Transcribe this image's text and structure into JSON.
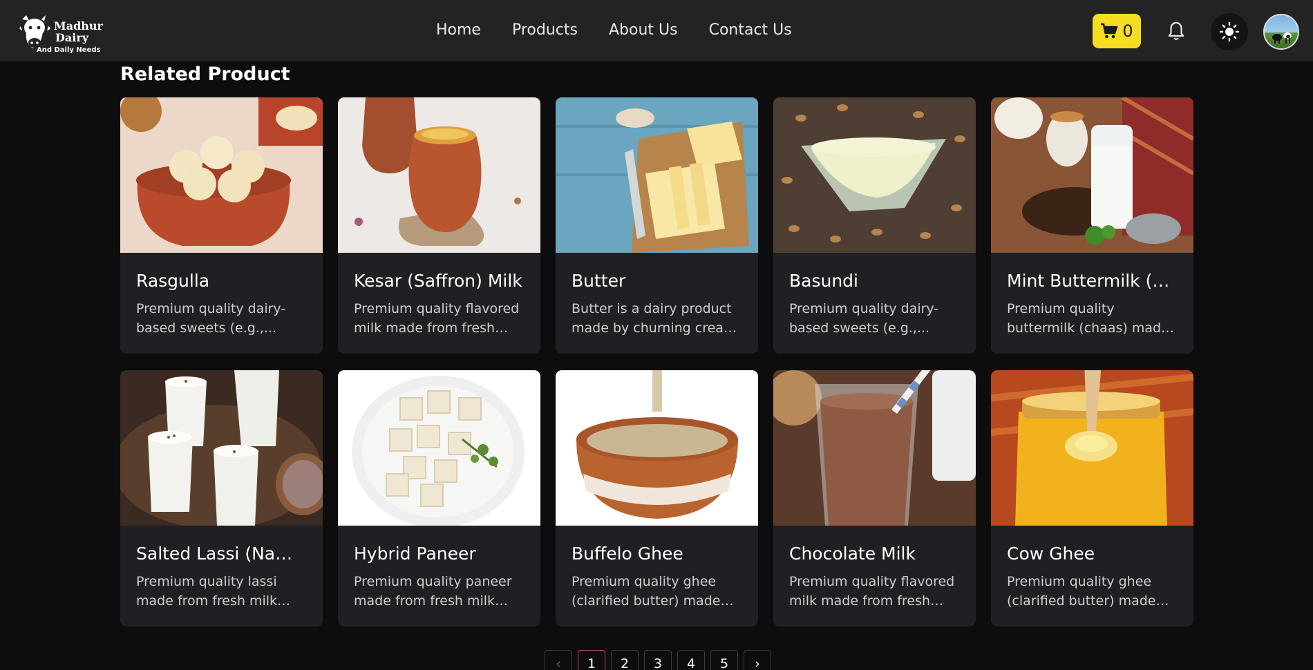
{
  "brand": {
    "name_line1": "Madhur",
    "name_line2": "Dairy",
    "tagline": "And Daily Needs"
  },
  "nav": {
    "items": [
      {
        "label": "Home"
      },
      {
        "label": "Products"
      },
      {
        "label": "About Us"
      },
      {
        "label": "Contact Us"
      }
    ]
  },
  "cart": {
    "count": "0",
    "icon": "cart-icon"
  },
  "colors": {
    "accent": "#f6dc22",
    "header_bg": "#232323",
    "page_bg": "#0d0d0e",
    "card_bg": "#1f2023",
    "active_page_border": "#c24a6a"
  },
  "section_title": "Related Product",
  "products": [
    {
      "title": "Rasgulla",
      "desc": "Premium quality dairy-based sweets (e.g.,...",
      "image": "rasgulla"
    },
    {
      "title": "Kesar (Saffron) Milk",
      "desc": "Premium quality flavored milk made from fresh milk...",
      "image": "kesar-milk"
    },
    {
      "title": "Butter",
      "desc": "Butter is a dairy product made by churning cream o...",
      "image": "butter"
    },
    {
      "title": "Basundi",
      "desc": "Premium quality dairy-based sweets (e.g.,...",
      "image": "basundi"
    },
    {
      "title": "Mint Buttermilk (Pu...",
      "desc": "Premium quality buttermilk (chaas) made from fresh...",
      "image": "mint-buttermilk"
    },
    {
      "title": "Salted Lassi (Namk...",
      "desc": "Premium quality lassi made from fresh milk and...",
      "image": "salted-lassi"
    },
    {
      "title": "Hybrid Paneer",
      "desc": "Premium quality paneer made from fresh milk and...",
      "image": "paneer"
    },
    {
      "title": "Buffelo Ghee",
      "desc": "Premium quality ghee (clarified butter) made fro...",
      "image": "buffelo-ghee"
    },
    {
      "title": "Chocolate Milk",
      "desc": "Premium quality flavored milk made from fresh milk...",
      "image": "chocolate-milk"
    },
    {
      "title": "Cow Ghee",
      "desc": "Premium quality ghee (clarified butter) made fro...",
      "image": "cow-ghee"
    }
  ],
  "pagination": {
    "prev": "‹",
    "next": "›",
    "pages": [
      "1",
      "2",
      "3",
      "4",
      "5"
    ],
    "current": "1"
  }
}
